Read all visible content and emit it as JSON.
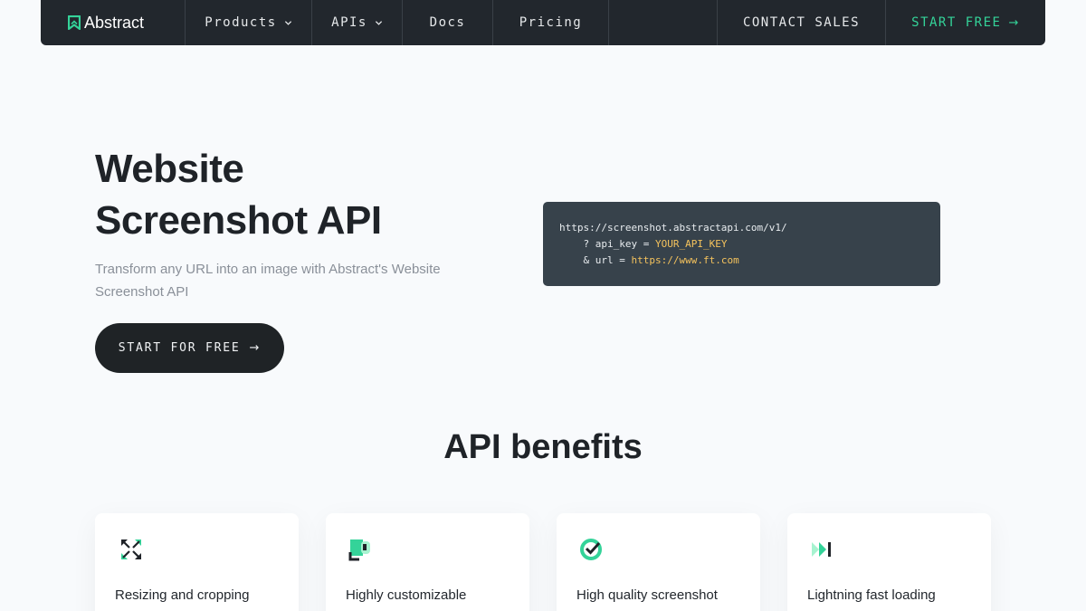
{
  "nav": {
    "brand": "Abstract",
    "products": "Products",
    "apis": "APIs",
    "docs": "Docs",
    "pricing": "Pricing",
    "contact_sales": "CONTACT SALES",
    "start_free": "START FREE",
    "arrow": "→"
  },
  "hero": {
    "title_line1": "Website",
    "title_line2": "Screenshot API",
    "subtitle": "Transform any URL into an image with Abstract's Website Screenshot API",
    "button_label": "START FOR FREE",
    "button_arrow": "→"
  },
  "code": {
    "endpoint": "https://screenshot.abstractapi.com/v1/",
    "param1_prefix": "    ? api_key = ",
    "param1_value": "YOUR_API_KEY",
    "param2_prefix": "    & url = ",
    "param2_value": "https://www.ft.com"
  },
  "benefits": {
    "title": "API benefits",
    "items": [
      {
        "label": "Resizing and cropping",
        "icon": "resize-icon"
      },
      {
        "label": "Highly customizable",
        "icon": "customize-icon"
      },
      {
        "label": "High quality screenshot",
        "icon": "quality-check-icon"
      },
      {
        "label": "Lightning fast loading",
        "icon": "fast-forward-icon"
      }
    ]
  },
  "colors": {
    "nav_bg": "#22272d",
    "accent_green": "#34d399",
    "code_bg": "#37424b",
    "code_value": "#f5c35d"
  }
}
